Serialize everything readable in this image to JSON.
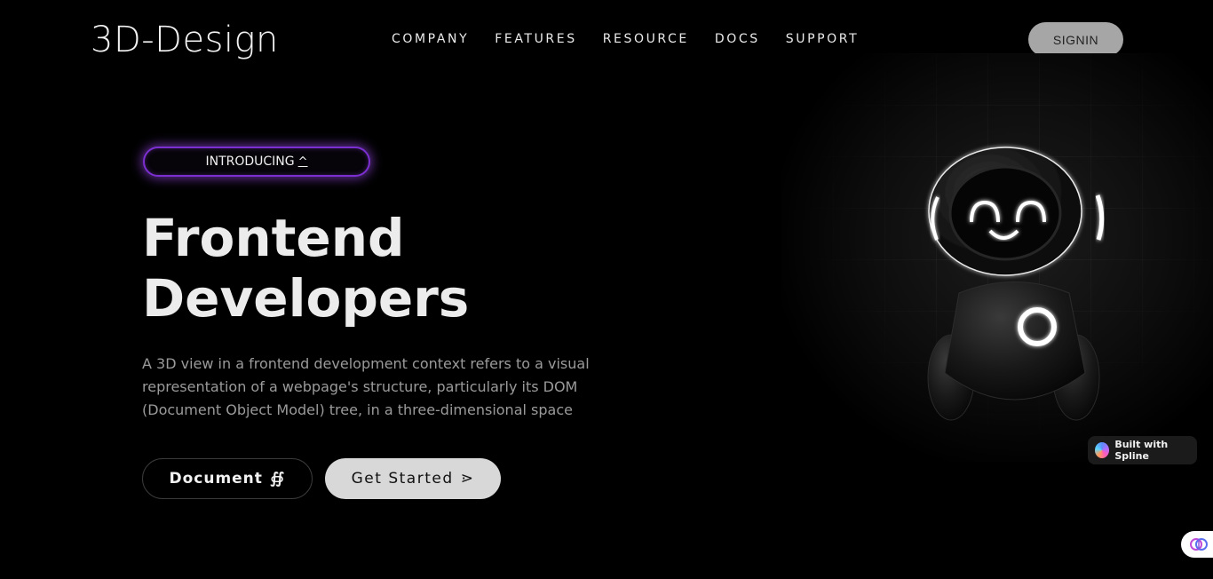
{
  "header": {
    "brand": "3D-Design",
    "nav": [
      "COMPANY",
      "FEATURES",
      "RESOURCE",
      "DOCS",
      "SUPPORT"
    ],
    "signin_label": "SIGNIN"
  },
  "hero": {
    "badge_label": "INTRODUCING",
    "badge_icon": "^",
    "title_line1": "Frontend",
    "title_line2": "Developers",
    "description": "A 3D view in a frontend development context refers to a visual representation of a webpage's structure, particularly its DOM (Document Object Model) tree, in a three-dimensional space",
    "document_button": "Document",
    "document_icon": "∯",
    "get_started_button": "Get Started",
    "get_started_icon": "⋗"
  },
  "spline_badge": {
    "label": "Built with Spline"
  },
  "icons": {
    "robot": "robot-illustration-icon",
    "spline": "spline-logo-icon",
    "brain": "brain-icon"
  },
  "colors": {
    "background": "#000000",
    "badge_glow": "#7c2fd1",
    "signin_bg": "#a6a6a6",
    "get_started_bg": "#d8d8d8"
  }
}
